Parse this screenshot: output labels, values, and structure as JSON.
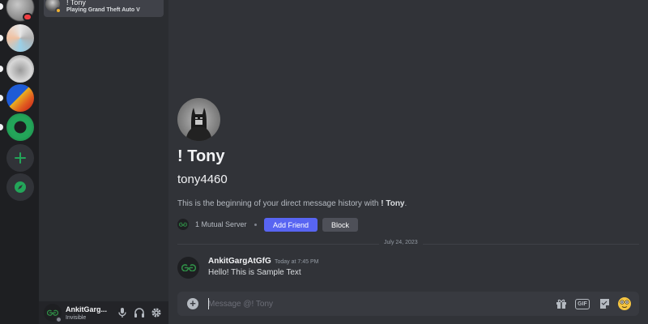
{
  "dm_list": {
    "active_dm": {
      "name": "! Tony",
      "activity": "Playing Grand Theft Auto V"
    }
  },
  "user_panel": {
    "name": "AnkitGarg...",
    "status": "Invisible"
  },
  "profile": {
    "display_name": "! Tony",
    "username": "tony4460",
    "intro_prefix": "This is the beginning of your direct message history with ",
    "intro_name": "! Tony",
    "intro_suffix": ".",
    "mutual_servers": "1 Mutual Server",
    "add_friend_label": "Add Friend",
    "block_label": "Block"
  },
  "date_divider": "July 24, 2023",
  "messages": [
    {
      "author": "AnkitGargAtGfG",
      "timestamp": "Today at 7:45 PM",
      "text": "Hello! This is Sample Text"
    }
  ],
  "composer": {
    "placeholder": "Message @! Tony",
    "gif_label": "GIF"
  },
  "colors": {
    "accent": "#5865f2",
    "online_green": "#23a559",
    "idle_yellow": "#f0b232",
    "mention_red": "#f23f43"
  }
}
